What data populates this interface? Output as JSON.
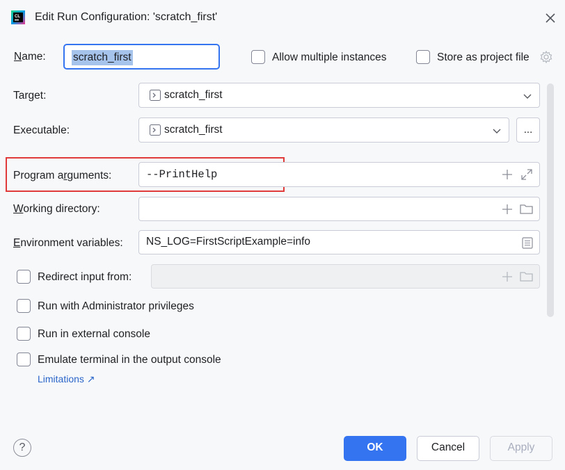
{
  "window": {
    "title": "Edit Run Configuration: 'scratch_first'",
    "app_icon": "clion-logo-icon",
    "close_icon": "close-icon"
  },
  "form": {
    "name": {
      "label": "Name:",
      "value": "scratch_first"
    },
    "allow_multiple": {
      "label": "Allow multiple instances",
      "checked": false
    },
    "store_project": {
      "label": "Store as project file",
      "checked": false,
      "icon": "gear-icon"
    },
    "target": {
      "label": "Target:",
      "value": "scratch_first",
      "icon": "terminal-icon"
    },
    "executable": {
      "label": "Executable:",
      "value": "scratch_first",
      "browse_label": "...",
      "icon": "terminal-icon"
    },
    "program_arguments": {
      "label": "Program arguments:",
      "value": "--PrintHelp"
    },
    "working_directory": {
      "label": "Working directory:",
      "value": ""
    },
    "environment_variables": {
      "label": "Environment variables:",
      "value": "NS_LOG=FirstScriptExample=info"
    },
    "redirect_input": {
      "label": "Redirect input from:",
      "checked": false,
      "value": ""
    },
    "run_admin": {
      "label": "Run with Administrator privileges",
      "checked": false
    },
    "run_external": {
      "label": "Run in external console",
      "checked": false
    },
    "emulate_terminal": {
      "label": "Emulate terminal in the output console",
      "checked": false
    },
    "limitations_link": "Limitations ↗"
  },
  "footer": {
    "help_label": "?",
    "ok_label": "OK",
    "cancel_label": "Cancel",
    "apply_label": "Apply"
  },
  "colors": {
    "accent": "#3574f0",
    "highlight": "#e03a3a",
    "link": "#2a65c9"
  }
}
